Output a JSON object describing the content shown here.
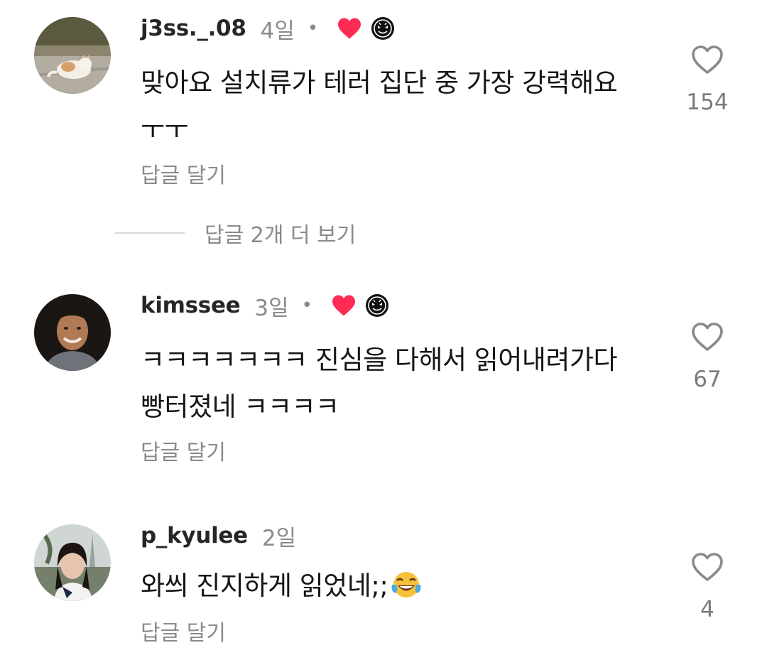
{
  "comments": [
    {
      "username": "j3ss._.08",
      "time": "4일",
      "dot": "•",
      "text_lines": [
        "맞아요 설치류가 테러 집단 중 가장 강력해요",
        "ㅜㅜ"
      ],
      "reply_label": "답글 달기",
      "like_count": "154",
      "creator_liked": true
    },
    {
      "username": "kimssee",
      "time": "3일",
      "dot": "•",
      "text_lines": [
        "ㅋㅋㅋㅋㅋㅋㅋ 진심을 다해서 읽어내려가다",
        "빵터졌네 ㅋㅋㅋㅋ"
      ],
      "reply_label": "답글 달기",
      "like_count": "67",
      "creator_liked": true
    },
    {
      "username": "p_kyulee",
      "time": "2일",
      "text": "와씌 진지하게 읽었네;;",
      "emoji": "face-with-tears-of-joy",
      "reply_label": "답글 달기",
      "like_count": "4",
      "creator_liked": false
    }
  ],
  "more_replies_label": "답글 2개 더 보기",
  "colors": {
    "username": "#262626",
    "secondary": "#8a8a8a",
    "text": "#161616",
    "heart_badge": "#fe2c55"
  },
  "icons": {
    "like": "heart-outline-icon",
    "creator_like_badge": "red-heart-icon",
    "creator_avatar_badge": "creator-avatar-badge"
  }
}
